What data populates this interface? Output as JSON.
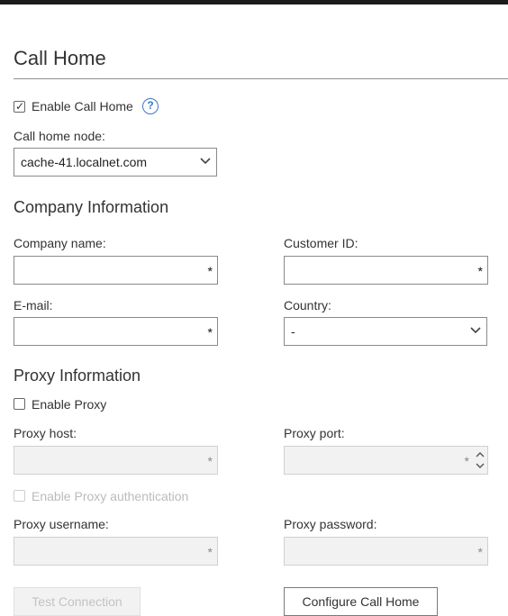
{
  "title": "Call Home",
  "enable_call_home": {
    "label": "Enable Call Home",
    "checked": true,
    "help_icon": "question-mark-icon"
  },
  "call_home_node": {
    "label": "Call home node:",
    "value": "cache-41.localnet.com"
  },
  "company": {
    "heading": "Company Information",
    "company_name": {
      "label": "Company name:",
      "value": "",
      "required_mark": "*"
    },
    "customer_id": {
      "label": "Customer ID:",
      "value": "",
      "required_mark": "*"
    },
    "email": {
      "label": "E-mail:",
      "value": "",
      "required_mark": "*"
    },
    "country": {
      "label": "Country:",
      "value": "-"
    }
  },
  "proxy": {
    "heading": "Proxy Information",
    "enable_proxy": {
      "label": "Enable Proxy",
      "checked": false
    },
    "host": {
      "label": "Proxy host:",
      "required_mark": "*"
    },
    "port": {
      "label": "Proxy port:",
      "required_mark": "*"
    },
    "enable_auth": {
      "label": "Enable Proxy authentication",
      "checked": false
    },
    "username": {
      "label": "Proxy username:",
      "required_mark": "*"
    },
    "password": {
      "label": "Proxy password:",
      "required_mark": "*"
    }
  },
  "buttons": {
    "test_connection": "Test Connection",
    "configure": "Configure Call Home"
  },
  "colors": {
    "accent": "#3a78c9",
    "disabled_fill": "#f2f2f2",
    "border": "#8a8a8a"
  }
}
